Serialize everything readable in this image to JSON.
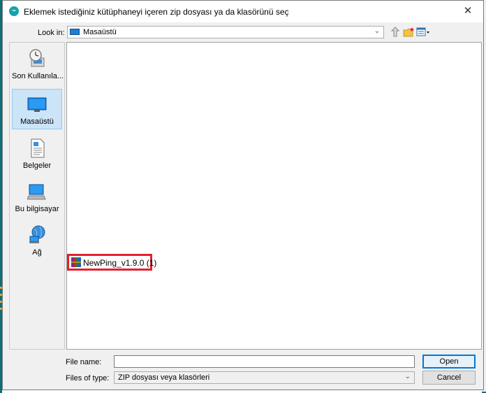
{
  "window": {
    "title": "Eklemek istediğiniz kütüphaneyi içeren zip dosyası ya da klasörünü seç",
    "app_icon_text": "∞",
    "close_symbol": "✕"
  },
  "look_in": {
    "label": "Look in:",
    "value": "Masaüstü",
    "dropdown_symbol": "⌄"
  },
  "toolbar": {
    "icons": [
      "up-folder-icon",
      "new-folder-icon",
      "view-menu-icon"
    ]
  },
  "places": [
    {
      "label": "Son Kullanıla...",
      "icon": "recent-clock-icon"
    },
    {
      "label": "Masaüstü",
      "icon": "desktop-icon",
      "active": true
    },
    {
      "label": "Belgeler",
      "icon": "documents-icon"
    },
    {
      "label": "Bu bilgisayar",
      "icon": "computer-icon"
    },
    {
      "label": "Ağ",
      "icon": "network-icon"
    }
  ],
  "files": [
    {
      "name": "NewPing_v1.9.0 (1)",
      "icon": "winrar-archive-icon",
      "highlighted": true
    }
  ],
  "file_name": {
    "label": "File name:",
    "value": ""
  },
  "file_type": {
    "label": "Files of type:",
    "value": "ZIP dosyası veya klasörleri",
    "dropdown_symbol": "⌄"
  },
  "buttons": {
    "open": "Open",
    "cancel": "Cancel"
  },
  "colors": {
    "highlight_border": "#e2202e",
    "selected_place": "#cce4f7",
    "accent": "#0078d7",
    "app_icon": "#16a2ad"
  }
}
